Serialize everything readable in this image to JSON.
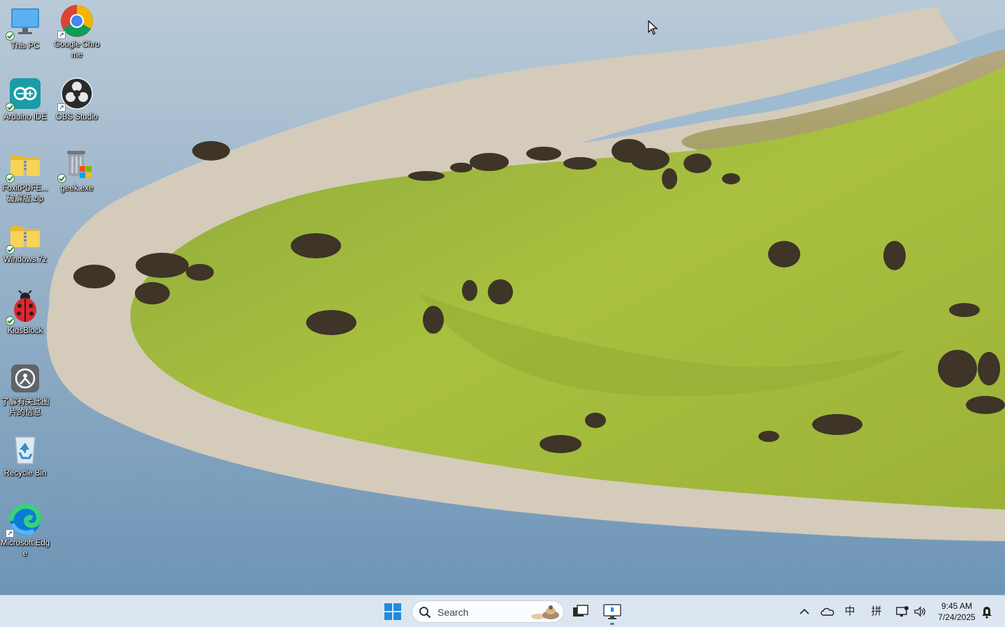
{
  "desktop": {
    "icons": [
      {
        "label": "This PC"
      },
      {
        "label": "Google Chrome"
      },
      {
        "label": "Arduino IDE"
      },
      {
        "label": "OBS Studio"
      },
      {
        "label": "FoxitPDFE... 破解版.zip"
      },
      {
        "label": "geek.exe"
      },
      {
        "label": "Windows.7z"
      },
      {
        "label": "KidsBlock"
      },
      {
        "label": "了解有关此图片的信息"
      },
      {
        "label": "Recycle Bin"
      },
      {
        "label": "Microsoft Edge"
      }
    ]
  },
  "taskbar": {
    "search_placeholder": "Search",
    "tray": {
      "ime_mode": "中",
      "ime_pinyin": "拼"
    },
    "clock": {
      "time": "9:45 AM",
      "date": "7/24/2025"
    }
  },
  "colors": {
    "taskbar_bg": "#dce6f0",
    "start_blue": "#1f8be0",
    "water": "#7fa3c0",
    "grass": "#a4bb3a"
  }
}
